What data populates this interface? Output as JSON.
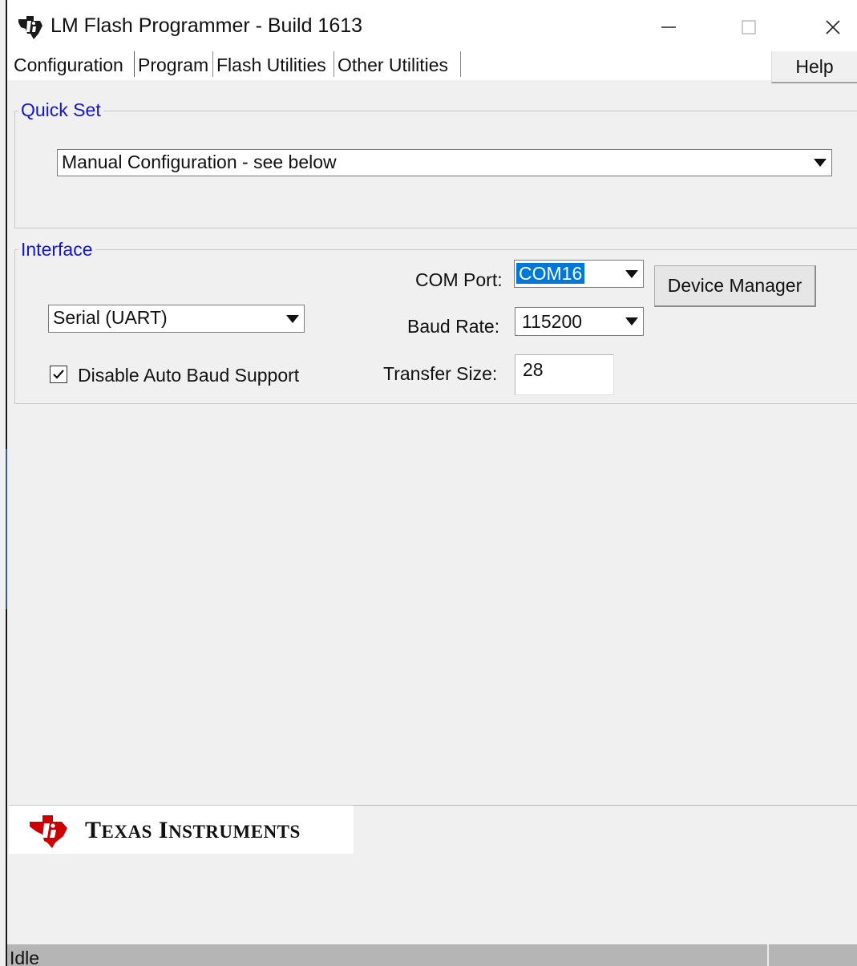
{
  "window": {
    "title": "LM Flash Programmer - Build 1613"
  },
  "tabs": [
    {
      "label": "Configuration",
      "active": true
    },
    {
      "label": "Program",
      "active": false
    },
    {
      "label": "Flash Utilities",
      "active": false
    },
    {
      "label": "Other Utilities",
      "active": false
    }
  ],
  "help_label": "Help",
  "quick_set": {
    "legend": "Quick Set",
    "selected": "Manual Configuration - see below"
  },
  "interface": {
    "legend": "Interface",
    "type_selected": "Serial (UART)",
    "com_port_label": "COM Port:",
    "com_port_value": "COM16",
    "device_manager_label": "Device Manager",
    "baud_rate_label": "Baud Rate:",
    "baud_rate_value": "115200",
    "transfer_size_label": "Transfer Size:",
    "transfer_size_value": "28",
    "disable_auto_baud_label": "Disable Auto Baud Support",
    "disable_auto_baud_checked": true
  },
  "logo": {
    "first": "T",
    "first_rest": "EXAS",
    "second": "I",
    "second_rest": "NSTRUMENTS"
  },
  "status": {
    "text": "Idle"
  },
  "colors": {
    "legend_blue": "#1414d8",
    "selection_blue": "#0078d7",
    "ti_red": "#cc0000"
  },
  "icons": {
    "app": "ti-logo-icon",
    "minimize": "minimize-icon",
    "maximize": "maximize-icon",
    "close": "close-icon",
    "dropdown": "chevron-down-icon",
    "check": "check-icon"
  }
}
